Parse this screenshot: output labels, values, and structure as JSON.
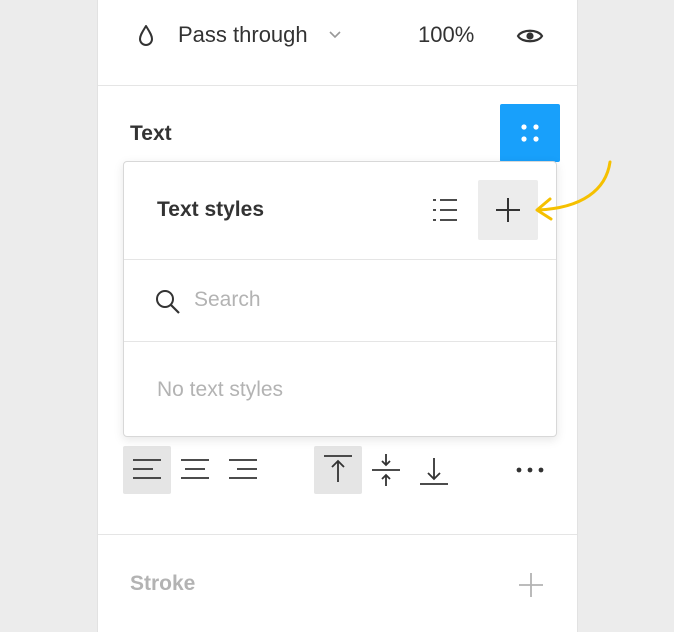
{
  "layer": {
    "blend_mode": "Pass through",
    "opacity": "100%",
    "icons": {
      "blend": "drop-icon",
      "dropdown": "chevron-down-icon",
      "visibility": "eye-icon"
    }
  },
  "text_section": {
    "title": "Text",
    "styles_button_icon": "four-dots-icon",
    "accent_color": "#18a0fb"
  },
  "text_styles_popover": {
    "title": "Text styles",
    "list_icon": "list-view-icon",
    "add_icon": "plus-icon",
    "search": {
      "placeholder": "Search",
      "value": ""
    },
    "empty_message": "No text styles"
  },
  "alignment": {
    "horizontal": [
      {
        "icon": "align-left-icon",
        "selected": true
      },
      {
        "icon": "align-center-icon",
        "selected": false
      },
      {
        "icon": "align-right-icon",
        "selected": false
      }
    ],
    "vertical": [
      {
        "icon": "align-top-icon",
        "selected": true
      },
      {
        "icon": "align-middle-icon",
        "selected": false
      },
      {
        "icon": "align-bottom-icon",
        "selected": false
      }
    ],
    "more_icon": "more-dots-icon"
  },
  "stroke_section": {
    "title": "Stroke",
    "add_icon": "plus-icon"
  },
  "annotation": {
    "arrow_color": "#f5c000",
    "icon": "curved-arrow-icon"
  }
}
